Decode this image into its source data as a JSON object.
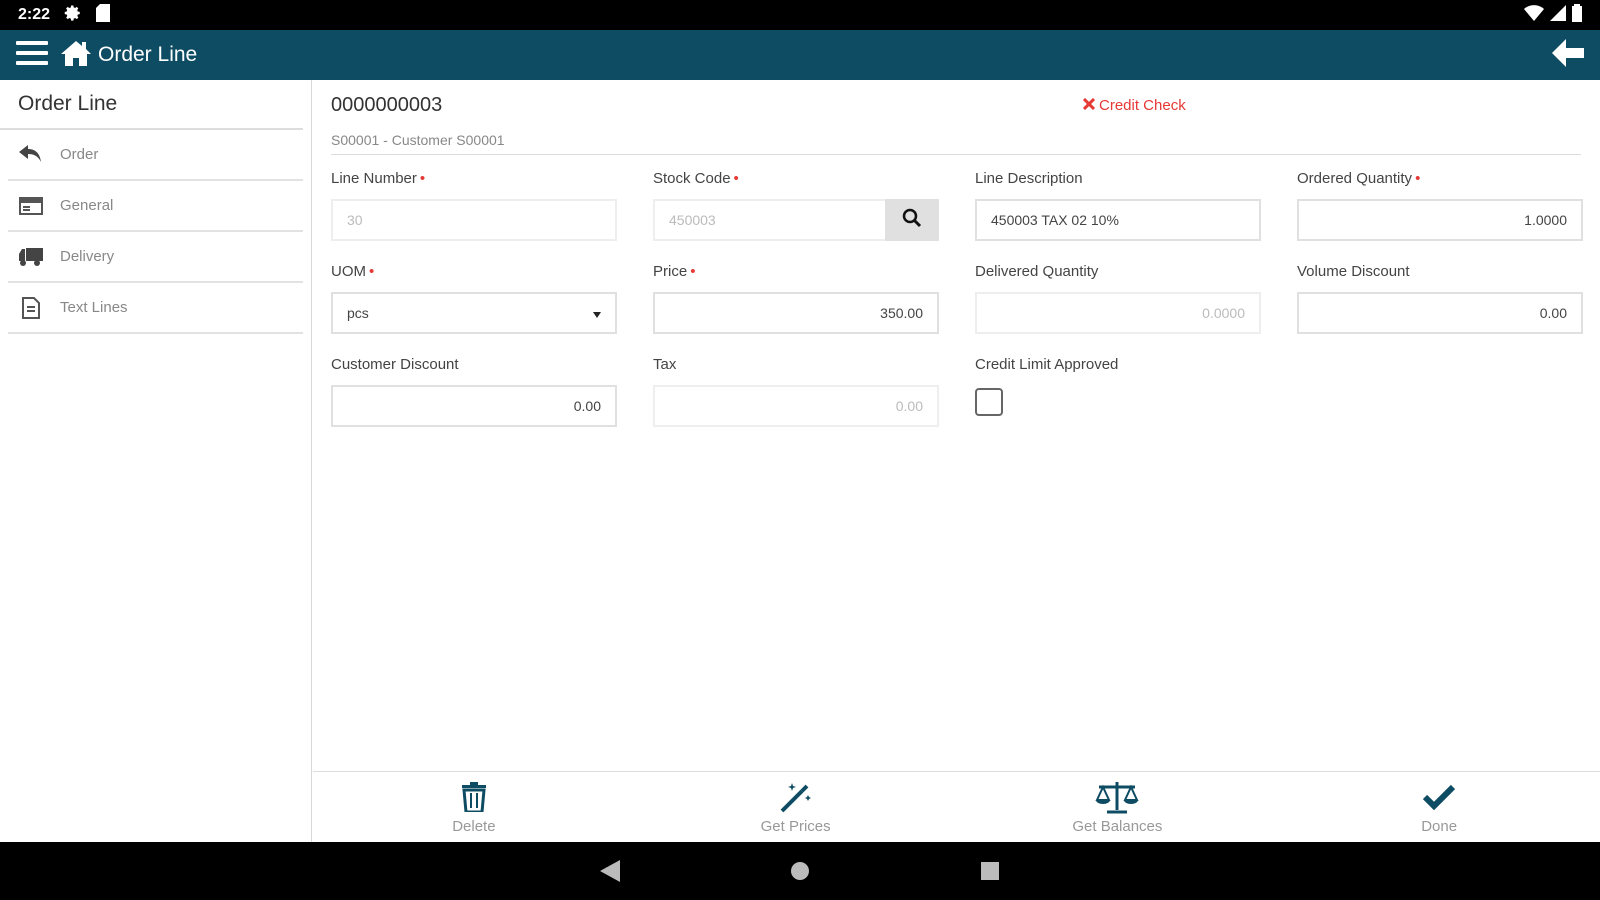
{
  "status_bar": {
    "time": "2:22"
  },
  "app_bar": {
    "title": "Order Line"
  },
  "sidebar": {
    "heading": "Order Line",
    "items": [
      {
        "label": "Order",
        "icon": "undo-icon"
      },
      {
        "label": "General",
        "icon": "window-icon"
      },
      {
        "label": "Delivery",
        "icon": "truck-icon"
      },
      {
        "label": "Text Lines",
        "icon": "document-icon"
      }
    ]
  },
  "header": {
    "order_number": "0000000003",
    "credit_check": "Credit Check",
    "customer": "S00001 - Customer S00001"
  },
  "fields": {
    "line_number": {
      "label": "Line Number",
      "value": "30"
    },
    "stock_code": {
      "label": "Stock Code",
      "value": "450003"
    },
    "line_description": {
      "label": "Line Description",
      "value": "450003 TAX 02 10%"
    },
    "ordered_quantity": {
      "label": "Ordered Quantity",
      "value": "1.0000"
    },
    "uom": {
      "label": "UOM",
      "value": "pcs"
    },
    "price": {
      "label": "Price",
      "value": "350.00"
    },
    "delivered_quantity": {
      "label": "Delivered Quantity",
      "value": "0.0000"
    },
    "volume_discount": {
      "label": "Volume Discount",
      "value": "0.00"
    },
    "customer_discount": {
      "label": "Customer Discount",
      "value": "0.00"
    },
    "tax": {
      "label": "Tax",
      "value": "0.00"
    },
    "credit_limit_approved": {
      "label": "Credit Limit Approved",
      "checked": false
    }
  },
  "toolbar": {
    "delete": "Delete",
    "get_prices": "Get Prices",
    "get_balances": "Get Balances",
    "done": "Done"
  },
  "colors": {
    "primary": "#0e4c64",
    "required": "#e53935"
  }
}
